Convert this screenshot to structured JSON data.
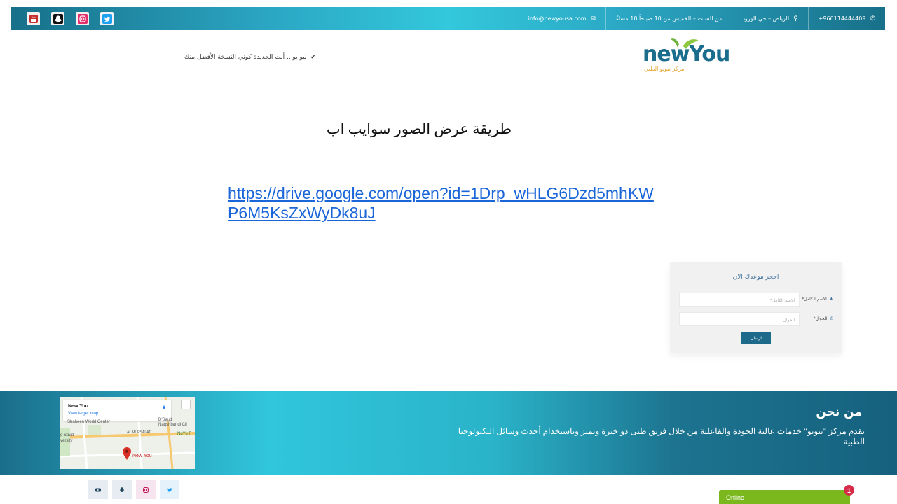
{
  "topbar": {
    "social": [
      {
        "icon": "youtube-icon",
        "color": "#c4302b"
      },
      {
        "icon": "snapchat-icon",
        "color": "#111111"
      },
      {
        "icon": "instagram-icon",
        "color": "#e1306c"
      },
      {
        "icon": "twitter-icon",
        "color": "#1da1f2"
      }
    ],
    "phone": "966114444409+",
    "location": "الرياض – حي الورود",
    "hours": "من السبت – الخميس من 10 صباحاً 10 مساءً",
    "email": "info@newyousa.com"
  },
  "header": {
    "logo_word": "newYou",
    "logo_sub": "مركز نيويو الطبي",
    "tagline": "نيو يو .. أنت الجديدة كوني النسخة الأفضل منك"
  },
  "main": {
    "title": "طريقة عرض الصور سوايب اب",
    "link": "https://drive.google.com/open?id=1Drp_wHLG6Dzd5mhKWP6M5KsZxWyDk8uJ"
  },
  "form": {
    "title": "احجز موعدك الان",
    "name_label": "الاسم الكامل*",
    "name_placeholder": "الاسم الكامل*",
    "phone_label": "الجوال*",
    "phone_placeholder": "الجوال",
    "submit": "ارسال"
  },
  "about": {
    "title": "من نحن",
    "text": "يقدم مركز \"نيويو\" خدمات عالية الجودة والفاعلية من خلال فريق طبى ذو خبرة وتميز وباستخدام أحدث وسائل التكنولوجيا الطبية"
  },
  "map": {
    "name": "New You",
    "link": "View larger map",
    "labels": {
      "shaheen": "Shaheen World Center",
      "naqshbandi": "D'Saud Naqshbandi Cli",
      "mursalat": "AL MURSALAT",
      "nuyu": "NuYu F",
      "saud": "g Saud",
      "versity": "versity",
      "pin": "New You"
    }
  },
  "chat": {
    "label": "Online",
    "badge": "1"
  }
}
